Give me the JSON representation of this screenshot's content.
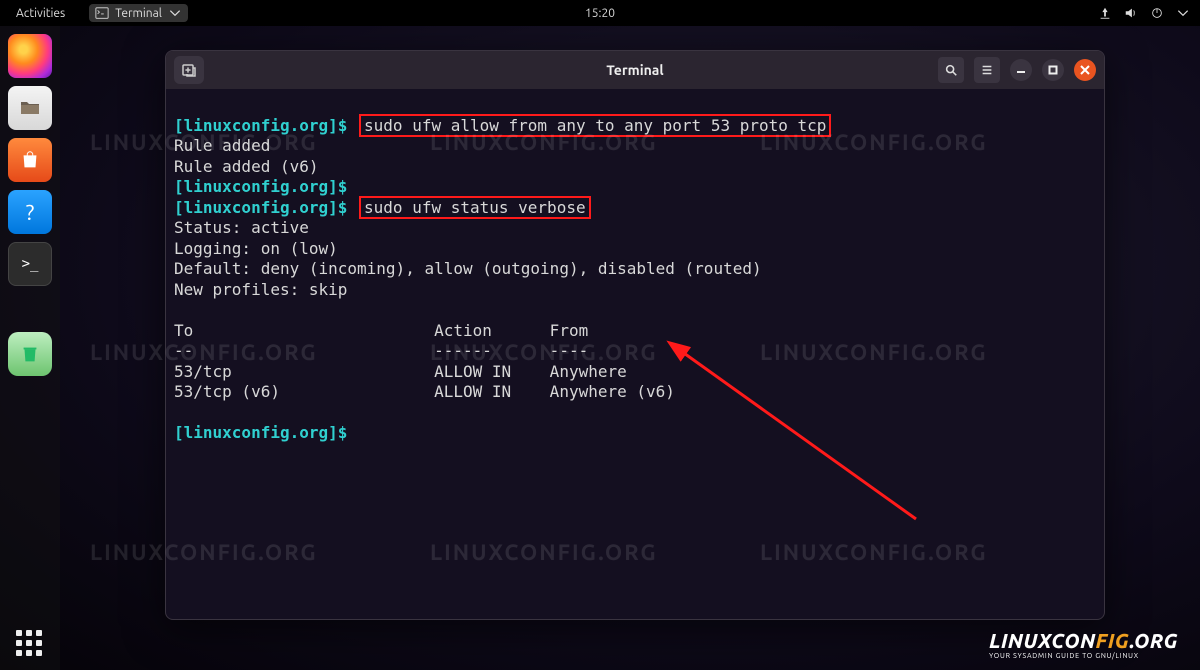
{
  "topbar": {
    "activities": "Activities",
    "app_label": "Terminal",
    "clock": "15:20"
  },
  "dock": {
    "items": [
      {
        "name": "firefox",
        "char": ""
      },
      {
        "name": "files",
        "char": ""
      },
      {
        "name": "software",
        "char": "A"
      },
      {
        "name": "help",
        "char": "?"
      },
      {
        "name": "terminal",
        "char": ">_"
      },
      {
        "name": "trash",
        "char": "♻"
      }
    ]
  },
  "terminal_window": {
    "title": "Terminal",
    "content": {
      "prompt": "[linuxconfig.org]$",
      "cmd1": "sudo ufw allow from any to any port 53 proto tcp",
      "out1_a": "Rule added",
      "out1_b": "Rule added (v6)",
      "cmd2": "sudo ufw status verbose",
      "status": "Status: active",
      "logging": "Logging: on (low)",
      "default": "Default: deny (incoming), allow (outgoing), disabled (routed)",
      "newprofiles": "New profiles: skip",
      "header": "To                         Action      From",
      "divider": "--                         ------      ----",
      "row1": "53/tcp                     ALLOW IN    Anywhere",
      "row2": "53/tcp (v6)                ALLOW IN    Anywhere (v6)"
    }
  },
  "watermark_text": "LINUXCONFIG.ORG",
  "brand": {
    "a": "LINUXCON",
    "b": "FIG",
    "c": ".ORG",
    "sub": "YOUR SYSADMIN GUIDE TO GNU/LINUX"
  }
}
